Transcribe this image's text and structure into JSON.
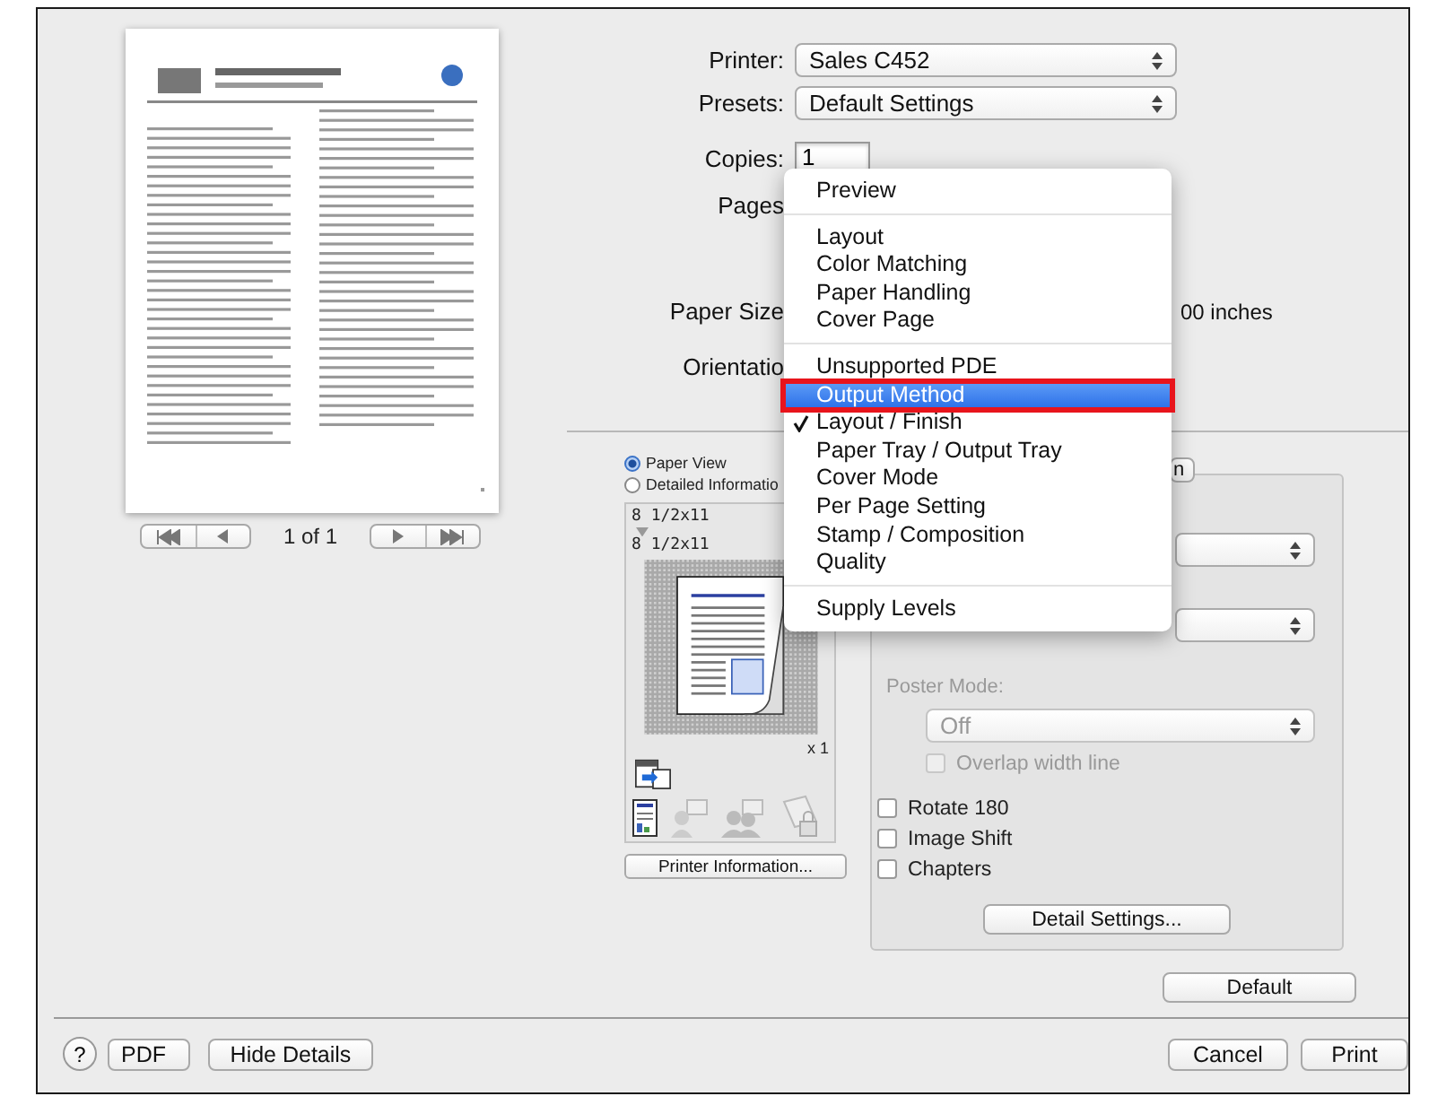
{
  "preview": {
    "page_indicator": "1 of 1"
  },
  "printer": {
    "label": "Printer:",
    "value": "Sales C452"
  },
  "presets": {
    "label": "Presets:",
    "value": "Default Settings"
  },
  "copies": {
    "label": "Copies:",
    "value": "1"
  },
  "pages": {
    "label": "Pages"
  },
  "paper_size": {
    "label": "Paper Size",
    "value": "00 inches"
  },
  "orientation": {
    "label": "Orientatio"
  },
  "panel_menu": {
    "items": [
      {
        "kind": "item",
        "label": "Preview",
        "checked": false,
        "selected": false
      },
      {
        "kind": "separator"
      },
      {
        "kind": "item",
        "label": "Layout",
        "checked": false,
        "selected": false
      },
      {
        "kind": "item",
        "label": "Color Matching",
        "checked": false,
        "selected": false
      },
      {
        "kind": "item",
        "label": "Paper Handling",
        "checked": false,
        "selected": false
      },
      {
        "kind": "item",
        "label": "Cover Page",
        "checked": false,
        "selected": false
      },
      {
        "kind": "separator"
      },
      {
        "kind": "item",
        "label": "Unsupported PDE",
        "checked": false,
        "selected": false
      },
      {
        "kind": "item",
        "label": "Output Method",
        "checked": false,
        "selected": true
      },
      {
        "kind": "item",
        "label": "Layout / Finish",
        "checked": true,
        "selected": false
      },
      {
        "kind": "item",
        "label": "Paper Tray / Output Tray",
        "checked": false,
        "selected": false
      },
      {
        "kind": "item",
        "label": "Cover Mode",
        "checked": false,
        "selected": false
      },
      {
        "kind": "item",
        "label": "Per Page Setting",
        "checked": false,
        "selected": false
      },
      {
        "kind": "item",
        "label": "Stamp / Composition",
        "checked": false,
        "selected": false
      },
      {
        "kind": "item",
        "label": "Quality",
        "checked": false,
        "selected": false
      },
      {
        "kind": "separator"
      },
      {
        "kind": "item",
        "label": "Supply Levels",
        "checked": false,
        "selected": false
      }
    ]
  },
  "view_options": [
    {
      "label": "Paper View",
      "selected": true
    },
    {
      "label": "Detailed Informatio",
      "selected": false
    }
  ],
  "paper_from": "8 1/2x11",
  "paper_to": "8 1/2x11",
  "copies_mark": "x 1",
  "printer_info_button": "Printer Information...",
  "covered_button": "n",
  "poster_mode": {
    "label": "Poster Mode:",
    "value": "Off",
    "disabled": true
  },
  "options": [
    {
      "label": "Overlap width line",
      "checked": false,
      "disabled": true
    },
    {
      "label": "Rotate 180",
      "checked": false,
      "disabled": false
    },
    {
      "label": "Image Shift",
      "checked": false,
      "disabled": false
    },
    {
      "label": "Chapters",
      "checked": false,
      "disabled": false
    }
  ],
  "detail_settings_button": "Detail Settings...",
  "default_button": "Default",
  "footer": {
    "help": "?",
    "pdf": "PDF",
    "hide_details": "Hide Details",
    "cancel": "Cancel",
    "print": "Print"
  }
}
